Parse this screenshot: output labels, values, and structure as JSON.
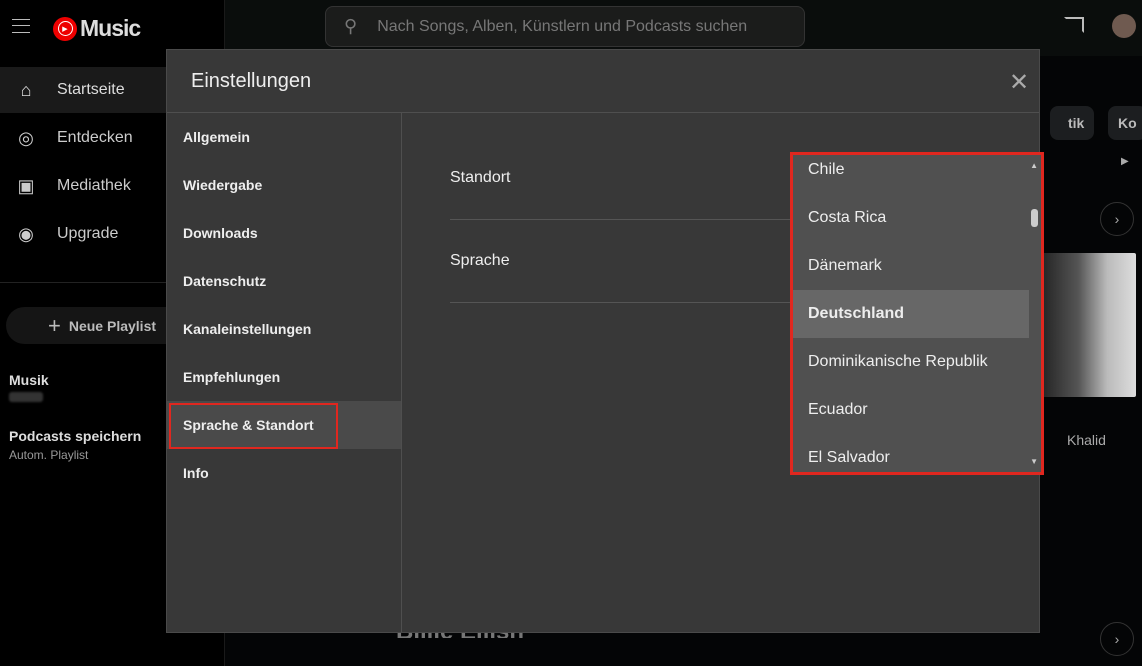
{
  "app": {
    "logo_text": "Music"
  },
  "search": {
    "placeholder": "Nach Songs, Alben, Künstlern und Podcasts suchen"
  },
  "sidebar": {
    "items": [
      {
        "label": "Startseite",
        "icon": "home-icon"
      },
      {
        "label": "Entdecken",
        "icon": "compass-icon"
      },
      {
        "label": "Mediathek",
        "icon": "library-icon"
      },
      {
        "label": "Upgrade",
        "icon": "upgrade-icon"
      }
    ],
    "new_playlist": "Neue Playlist",
    "playlists": [
      {
        "title": "Musik"
      },
      {
        "title": "Podcasts speichern",
        "subtitle": "Autom. Playlist"
      }
    ]
  },
  "background": {
    "chips": [
      "tik",
      "Ko"
    ],
    "artist_label": "Khalid",
    "bottom_title": "Billie Eilish"
  },
  "dialog": {
    "title": "Einstellungen",
    "menu": [
      "Allgemein",
      "Wiedergabe",
      "Downloads",
      "Datenschutz",
      "Kanaleinstellungen",
      "Empfehlungen",
      "Sprache & Standort",
      "Info"
    ],
    "active_menu": "Sprache & Standort",
    "rows": [
      "Standort",
      "Sprache"
    ],
    "dropdown": {
      "options": [
        "Chile",
        "Costa Rica",
        "Dänemark",
        "Deutschland",
        "Dominikanische Republik",
        "Ecuador",
        "El Salvador"
      ],
      "selected": "Deutschland"
    }
  },
  "colors": {
    "highlight": "#e0271f",
    "brand": "#ff0000"
  }
}
